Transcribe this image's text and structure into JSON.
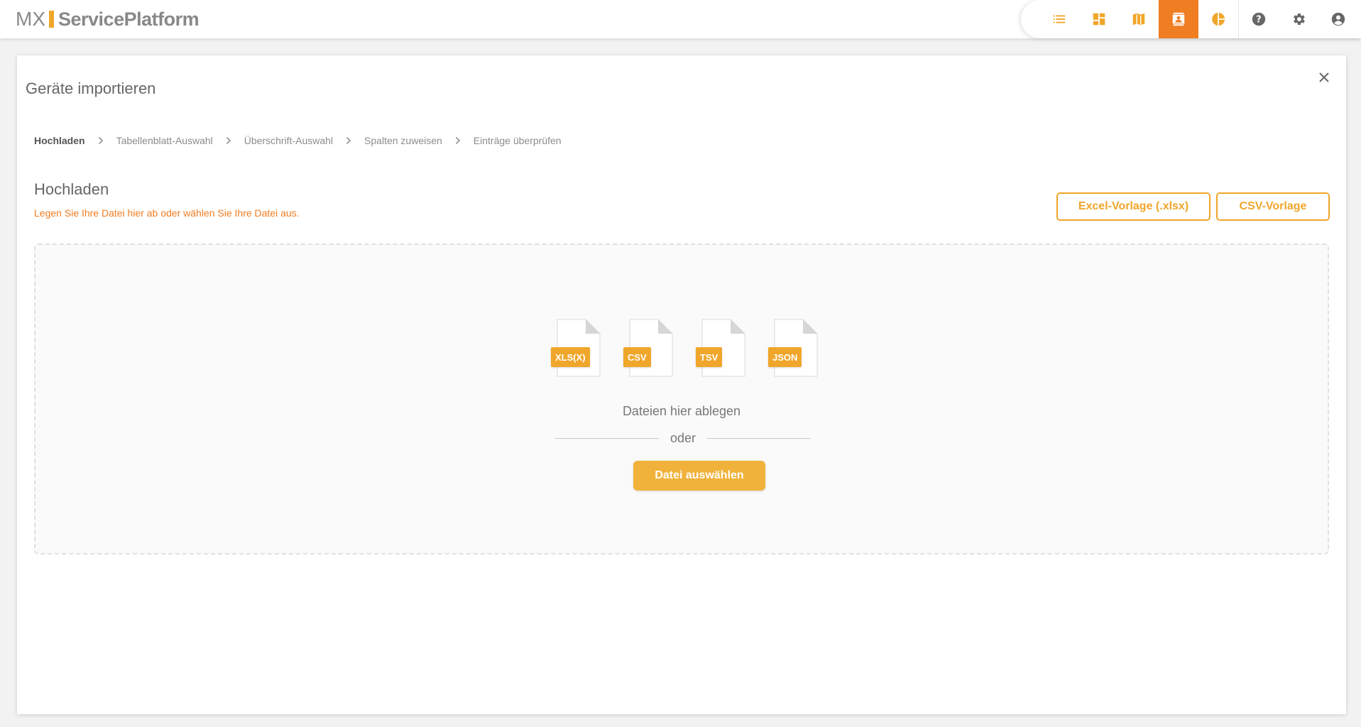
{
  "app": {
    "logo_prefix": "MX",
    "logo_name": "ServicePlatform"
  },
  "nav": {
    "icons": [
      "list-icon",
      "dashboard-icon",
      "map-icon",
      "contact-card-icon",
      "pie-chart-icon",
      "help-icon",
      "settings-icon",
      "account-icon"
    ],
    "active_icon": "contact-card-icon",
    "accent_color": "#ef7d22"
  },
  "modal": {
    "title": "Geräte importieren"
  },
  "stepper": {
    "steps": [
      {
        "label": "Hochladen",
        "current": true
      },
      {
        "label": "Tabellenblatt-Auswahl",
        "current": false
      },
      {
        "label": "Überschrift-Auswahl",
        "current": false
      },
      {
        "label": "Spalten zuweisen",
        "current": false
      },
      {
        "label": "Einträge überprüfen",
        "current": false
      }
    ]
  },
  "upload": {
    "title": "Hochladen",
    "subtitle": "Legen Sie Ihre Datei hier ab oder wählen Sie Ihre Datei aus.",
    "excel_template_label": "Excel-Vorlage (.xlsx)",
    "csv_template_label": "CSV-Vorlage",
    "file_types": [
      "XLS(X)",
      "CSV",
      "TSV",
      "JSON"
    ],
    "drop_text": "Dateien hier ablegen",
    "or_text": "oder",
    "select_button_label": "Datei auswählen",
    "button_color": "#f0a62a"
  }
}
